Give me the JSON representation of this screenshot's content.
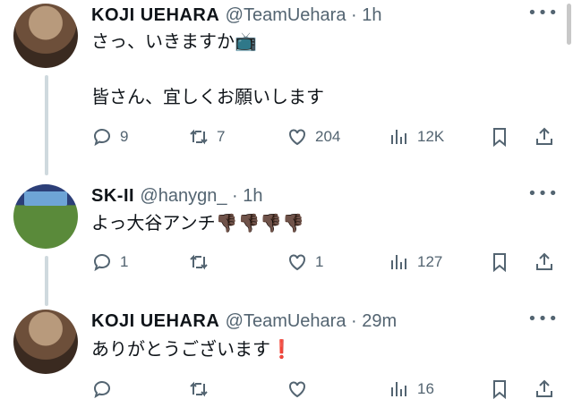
{
  "tweets": [
    {
      "name": "KOJI  UEHARA",
      "handle": "@TeamUehara",
      "time": "1h",
      "lines": [
        "さっ、いきますか📺",
        "",
        "皆さん、宜しくお願いします"
      ],
      "replies": "9",
      "retweets": "7",
      "likes": "204",
      "views": "12K"
    },
    {
      "name": "SK-II",
      "handle": "@hanygn_",
      "time": "1h",
      "lines": [
        "よっ大谷アンチ👎🏿👎🏿👎🏿👎🏿"
      ],
      "replies": "1",
      "retweets": "",
      "likes": "1",
      "views": "127"
    },
    {
      "name": "KOJI  UEHARA",
      "handle": "@TeamUehara",
      "time": "29m",
      "lines": [
        "ありがとうございます❗"
      ],
      "replies": "",
      "retweets": "",
      "likes": "",
      "views": "16"
    }
  ],
  "sep": " · ",
  "more_label": "•••"
}
